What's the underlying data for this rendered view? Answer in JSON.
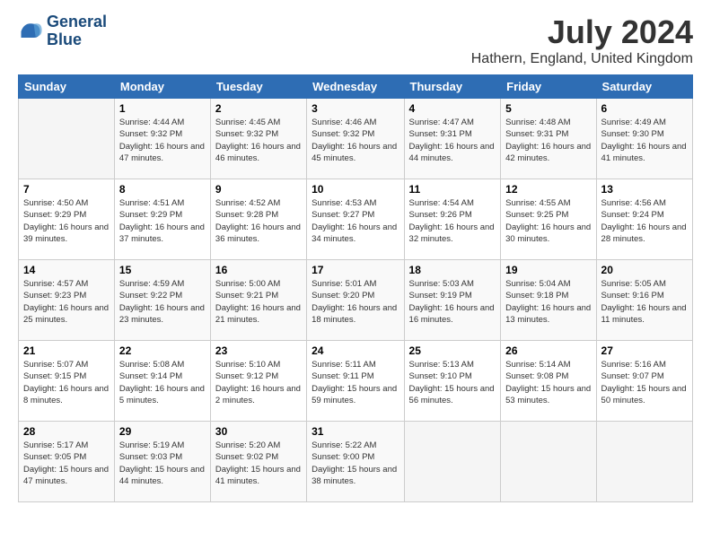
{
  "logo": {
    "line1": "General",
    "line2": "Blue"
  },
  "header": {
    "title": "July 2024",
    "location": "Hathern, England, United Kingdom"
  },
  "columns": [
    "Sunday",
    "Monday",
    "Tuesday",
    "Wednesday",
    "Thursday",
    "Friday",
    "Saturday"
  ],
  "weeks": [
    [
      {
        "day": "",
        "info": ""
      },
      {
        "day": "1",
        "info": "Sunrise: 4:44 AM\nSunset: 9:32 PM\nDaylight: 16 hours\nand 47 minutes."
      },
      {
        "day": "2",
        "info": "Sunrise: 4:45 AM\nSunset: 9:32 PM\nDaylight: 16 hours\nand 46 minutes."
      },
      {
        "day": "3",
        "info": "Sunrise: 4:46 AM\nSunset: 9:32 PM\nDaylight: 16 hours\nand 45 minutes."
      },
      {
        "day": "4",
        "info": "Sunrise: 4:47 AM\nSunset: 9:31 PM\nDaylight: 16 hours\nand 44 minutes."
      },
      {
        "day": "5",
        "info": "Sunrise: 4:48 AM\nSunset: 9:31 PM\nDaylight: 16 hours\nand 42 minutes."
      },
      {
        "day": "6",
        "info": "Sunrise: 4:49 AM\nSunset: 9:30 PM\nDaylight: 16 hours\nand 41 minutes."
      }
    ],
    [
      {
        "day": "7",
        "info": "Sunrise: 4:50 AM\nSunset: 9:29 PM\nDaylight: 16 hours\nand 39 minutes."
      },
      {
        "day": "8",
        "info": "Sunrise: 4:51 AM\nSunset: 9:29 PM\nDaylight: 16 hours\nand 37 minutes."
      },
      {
        "day": "9",
        "info": "Sunrise: 4:52 AM\nSunset: 9:28 PM\nDaylight: 16 hours\nand 36 minutes."
      },
      {
        "day": "10",
        "info": "Sunrise: 4:53 AM\nSunset: 9:27 PM\nDaylight: 16 hours\nand 34 minutes."
      },
      {
        "day": "11",
        "info": "Sunrise: 4:54 AM\nSunset: 9:26 PM\nDaylight: 16 hours\nand 32 minutes."
      },
      {
        "day": "12",
        "info": "Sunrise: 4:55 AM\nSunset: 9:25 PM\nDaylight: 16 hours\nand 30 minutes."
      },
      {
        "day": "13",
        "info": "Sunrise: 4:56 AM\nSunset: 9:24 PM\nDaylight: 16 hours\nand 28 minutes."
      }
    ],
    [
      {
        "day": "14",
        "info": "Sunrise: 4:57 AM\nSunset: 9:23 PM\nDaylight: 16 hours\nand 25 minutes."
      },
      {
        "day": "15",
        "info": "Sunrise: 4:59 AM\nSunset: 9:22 PM\nDaylight: 16 hours\nand 23 minutes."
      },
      {
        "day": "16",
        "info": "Sunrise: 5:00 AM\nSunset: 9:21 PM\nDaylight: 16 hours\nand 21 minutes."
      },
      {
        "day": "17",
        "info": "Sunrise: 5:01 AM\nSunset: 9:20 PM\nDaylight: 16 hours\nand 18 minutes."
      },
      {
        "day": "18",
        "info": "Sunrise: 5:03 AM\nSunset: 9:19 PM\nDaylight: 16 hours\nand 16 minutes."
      },
      {
        "day": "19",
        "info": "Sunrise: 5:04 AM\nSunset: 9:18 PM\nDaylight: 16 hours\nand 13 minutes."
      },
      {
        "day": "20",
        "info": "Sunrise: 5:05 AM\nSunset: 9:16 PM\nDaylight: 16 hours\nand 11 minutes."
      }
    ],
    [
      {
        "day": "21",
        "info": "Sunrise: 5:07 AM\nSunset: 9:15 PM\nDaylight: 16 hours\nand 8 minutes."
      },
      {
        "day": "22",
        "info": "Sunrise: 5:08 AM\nSunset: 9:14 PM\nDaylight: 16 hours\nand 5 minutes."
      },
      {
        "day": "23",
        "info": "Sunrise: 5:10 AM\nSunset: 9:12 PM\nDaylight: 16 hours\nand 2 minutes."
      },
      {
        "day": "24",
        "info": "Sunrise: 5:11 AM\nSunset: 9:11 PM\nDaylight: 15 hours\nand 59 minutes."
      },
      {
        "day": "25",
        "info": "Sunrise: 5:13 AM\nSunset: 9:10 PM\nDaylight: 15 hours\nand 56 minutes."
      },
      {
        "day": "26",
        "info": "Sunrise: 5:14 AM\nSunset: 9:08 PM\nDaylight: 15 hours\nand 53 minutes."
      },
      {
        "day": "27",
        "info": "Sunrise: 5:16 AM\nSunset: 9:07 PM\nDaylight: 15 hours\nand 50 minutes."
      }
    ],
    [
      {
        "day": "28",
        "info": "Sunrise: 5:17 AM\nSunset: 9:05 PM\nDaylight: 15 hours\nand 47 minutes."
      },
      {
        "day": "29",
        "info": "Sunrise: 5:19 AM\nSunset: 9:03 PM\nDaylight: 15 hours\nand 44 minutes."
      },
      {
        "day": "30",
        "info": "Sunrise: 5:20 AM\nSunset: 9:02 PM\nDaylight: 15 hours\nand 41 minutes."
      },
      {
        "day": "31",
        "info": "Sunrise: 5:22 AM\nSunset: 9:00 PM\nDaylight: 15 hours\nand 38 minutes."
      },
      {
        "day": "",
        "info": ""
      },
      {
        "day": "",
        "info": ""
      },
      {
        "day": "",
        "info": ""
      }
    ]
  ]
}
